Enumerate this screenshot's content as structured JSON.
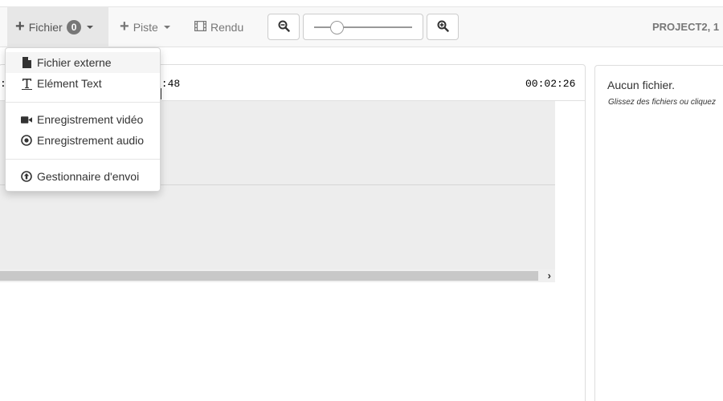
{
  "toolbar": {
    "fichier_label": "Fichier",
    "fichier_badge": "0",
    "piste_label": "Piste",
    "rendu_label": "Rendu",
    "project_name": "PROJECT2, 1"
  },
  "dropdown": {
    "items": [
      {
        "label": "Fichier externe",
        "icon": "file-icon"
      },
      {
        "label": "Elément Text",
        "icon": "text-icon"
      },
      {
        "label": "Enregistrement vidéo",
        "icon": "video-camera-icon"
      },
      {
        "label": "Enregistrement audio",
        "icon": "record-icon"
      },
      {
        "label": "Gestionnaire d'envoi",
        "icon": "upload-circle-icon"
      }
    ]
  },
  "timeline": {
    "time_left": ":",
    "time_mid": "0:48",
    "time_end": "00:02:26"
  },
  "files_panel": {
    "title": "Aucun fichier.",
    "hint": "Glissez des fichiers ou cliquez"
  },
  "colors": {
    "toolbar_bg": "#f8f8f8",
    "active_bg": "#e7e7e7",
    "track_bg": "#ededed",
    "badge_bg": "#777777"
  }
}
